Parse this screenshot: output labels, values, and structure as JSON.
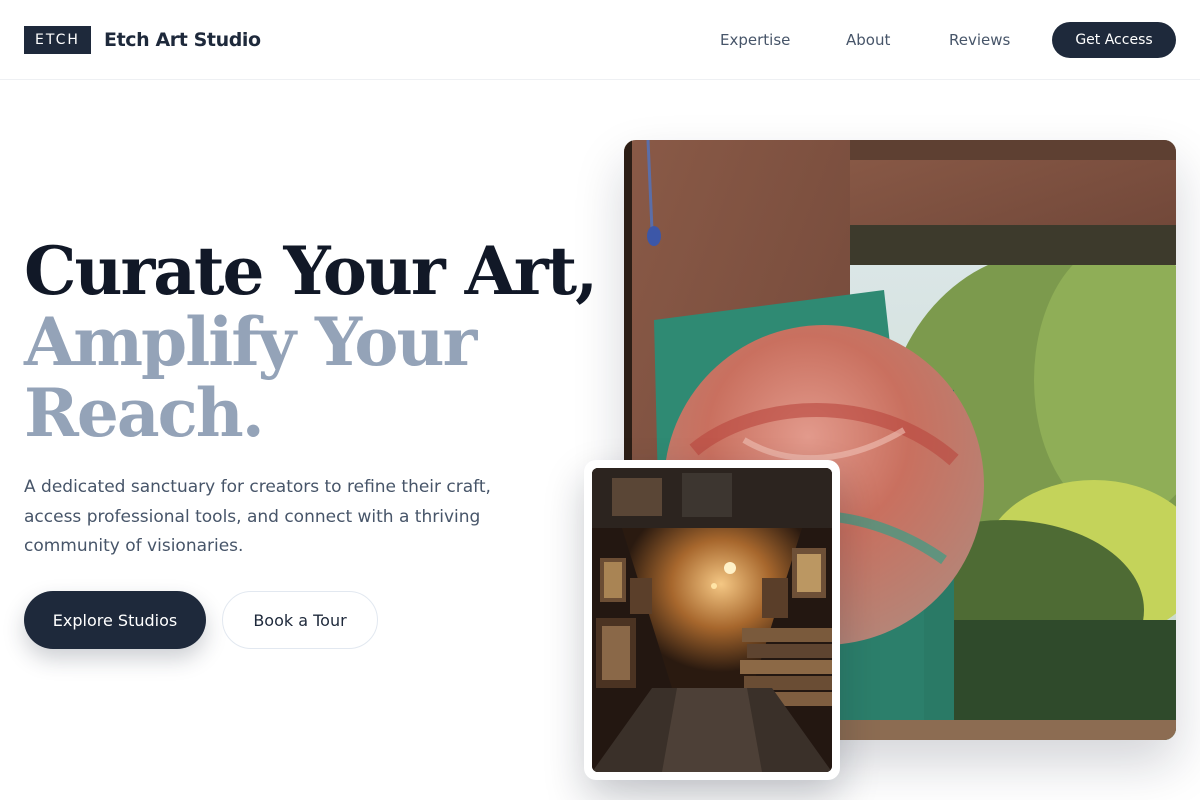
{
  "header": {
    "logo_mark": "ETCH",
    "logo_name": "Etch Art Studio",
    "nav": [
      "Expertise",
      "About",
      "Reviews"
    ],
    "cta_label": "Get Access"
  },
  "hero": {
    "headline_line1": "Curate Your Art,",
    "headline_line2": "Amplify Your",
    "headline_line3": "Reach.",
    "lead": "A dedicated sanctuary for creators to refine their craft, access professional tools, and connect with a thriving community of visionaries.",
    "primary_cta": "Explore Studios",
    "secondary_cta": "Book a Tour"
  },
  "colors": {
    "brand_dark": "#1e293b",
    "headline_dark": "#111827",
    "headline_muted": "#94a3b8",
    "body_text": "#475569"
  },
  "images": {
    "hero_art": "painted-relief-outdoor-photo",
    "gallery_interior": "art-storage-room-photo"
  }
}
